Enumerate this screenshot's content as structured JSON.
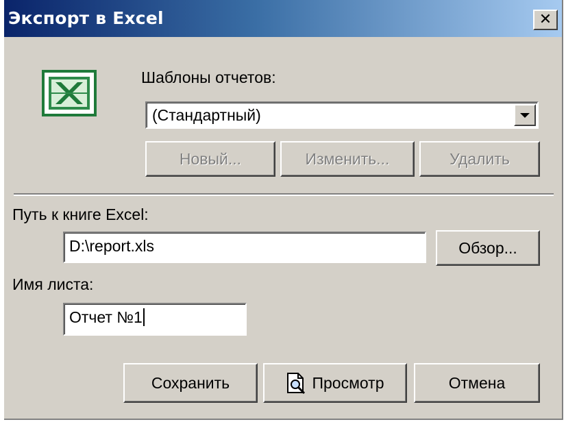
{
  "window": {
    "title": "Экспорт в Excel",
    "close_label": "✕"
  },
  "icons": {
    "app": "excel-icon",
    "close": "close-icon",
    "preview": "magnifier-page-icon"
  },
  "templates": {
    "label": "Шаблоны отчетов:",
    "selected": "(Стандартный)",
    "new_label": "Новый...",
    "edit_label": "Изменить...",
    "delete_label": "Удалить"
  },
  "path": {
    "label": "Путь к книге Excel:",
    "value": "D:\\report.xls",
    "browse_label": "Обзор..."
  },
  "sheet": {
    "label": "Имя листа:",
    "value": "Отчет №1"
  },
  "footer": {
    "save_label": "Сохранить",
    "preview_label": "Просмотр",
    "cancel_label": "Отмена"
  },
  "colors": {
    "dialog_bg": "#d4d0c8",
    "title_gradient_start": "#0a246a",
    "title_gradient_end": "#a6caf0",
    "excel_green": "#1f7a3a",
    "disabled_text": "#808080"
  }
}
